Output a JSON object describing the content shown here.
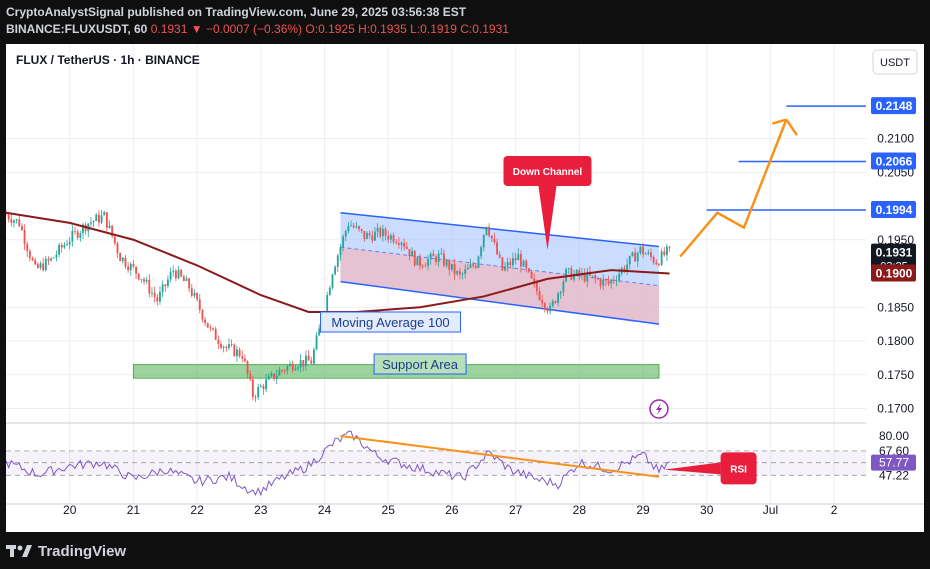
{
  "header": {
    "line1": "CryptoAnalystSignal published on TradingView.com, June 29, 2025 03:56:38 EST",
    "line2_symbol": "BINANCE:FLUXUSDT, 60",
    "line2_price": "0.1931",
    "line2_change": "−0.0007 (−0.36%)",
    "line2_o": "O:0.1925",
    "line2_h": "H:0.1935",
    "line2_l": "L:0.1919",
    "line2_c": "C:0.1931"
  },
  "legend": {
    "title": "FLUX / TetherUS · 1h · BINANCE"
  },
  "currency_button": "USDT",
  "footer": {
    "brand": "TradingView"
  },
  "colors": {
    "up": "#26a69a",
    "down": "#ef5350",
    "ma": "#8b1a1a",
    "channel": "#2962ff",
    "target": "#2962ff",
    "arrow": "#f7931a",
    "support": "#4caf50",
    "rsi": "#7e57c2",
    "rsi_trend": "#f7931a",
    "callout": "#e91e3d"
  },
  "chart_data": {
    "type": "candlestick",
    "timeframe": "1h",
    "y_axis": {
      "range": [
        0.168,
        0.224
      ],
      "ticks": [
        "0.2100",
        "0.2050",
        "0.1950",
        "0.1850",
        "0.1800",
        "0.1750",
        "0.1700"
      ]
    },
    "x_axis": {
      "range": [
        "2025-06-19 00:00",
        "2025-07-02 12:00"
      ],
      "ticks": [
        {
          "t": "2025-06-20",
          "label": "20"
        },
        {
          "t": "2025-06-21",
          "label": "21"
        },
        {
          "t": "2025-06-22",
          "label": "22"
        },
        {
          "t": "2025-06-23",
          "label": "23"
        },
        {
          "t": "2025-06-24",
          "label": "24"
        },
        {
          "t": "2025-06-25",
          "label": "25"
        },
        {
          "t": "2025-06-26",
          "label": "26"
        },
        {
          "t": "2025-06-27",
          "label": "27"
        },
        {
          "t": "2025-06-28",
          "label": "28"
        },
        {
          "t": "2025-06-29",
          "label": "29"
        },
        {
          "t": "2025-06-30",
          "label": "30"
        },
        {
          "t": "2025-07-01",
          "label": "Jul"
        },
        {
          "t": "2025-07-02",
          "label": "2"
        }
      ]
    },
    "price_path": [
      [
        "2025-06-19 00:00",
        0.199
      ],
      [
        "2025-06-19 06:00",
        0.1975
      ],
      [
        "2025-06-19 12:00",
        0.1905
      ],
      [
        "2025-06-19 18:00",
        0.192
      ],
      [
        "2025-06-20 00:00",
        0.1948
      ],
      [
        "2025-06-20 08:00",
        0.1975
      ],
      [
        "2025-06-20 14:00",
        0.1985
      ],
      [
        "2025-06-20 20:00",
        0.1925
      ],
      [
        "2025-06-21 04:00",
        0.1895
      ],
      [
        "2025-06-21 10:00",
        0.186
      ],
      [
        "2025-06-21 16:00",
        0.1905
      ],
      [
        "2025-06-21 22:00",
        0.188
      ],
      [
        "2025-06-22 06:00",
        0.1815
      ],
      [
        "2025-06-22 12:00",
        0.179
      ],
      [
        "2025-06-22 18:00",
        0.178
      ],
      [
        "2025-06-22 22:00",
        0.172
      ],
      [
        "2025-06-23 02:00",
        0.1735
      ],
      [
        "2025-06-23 08:00",
        0.1755
      ],
      [
        "2025-06-23 14:00",
        0.1768
      ],
      [
        "2025-06-23 20:00",
        0.177
      ],
      [
        "2025-06-24 00:00",
        0.183
      ],
      [
        "2025-06-24 04:00",
        0.1905
      ],
      [
        "2025-06-24 10:00",
        0.1975
      ],
      [
        "2025-06-24 16:00",
        0.1955
      ],
      [
        "2025-06-24 22:00",
        0.196
      ],
      [
        "2025-06-25 06:00",
        0.195
      ],
      [
        "2025-06-25 12:00",
        0.1915
      ],
      [
        "2025-06-25 20:00",
        0.1925
      ],
      [
        "2025-06-26 04:00",
        0.1895
      ],
      [
        "2025-06-26 10:00",
        0.1915
      ],
      [
        "2025-06-26 14:00",
        0.1975
      ],
      [
        "2025-06-26 20:00",
        0.1905
      ],
      [
        "2025-06-27 02:00",
        0.1925
      ],
      [
        "2025-06-27 08:00",
        0.188
      ],
      [
        "2025-06-27 14:00",
        0.1845
      ],
      [
        "2025-06-27 20:00",
        0.19
      ],
      [
        "2025-06-28 04:00",
        0.1895
      ],
      [
        "2025-06-28 12:00",
        0.1885
      ],
      [
        "2025-06-28 18:00",
        0.191
      ],
      [
        "2025-06-29 00:00",
        0.1935
      ],
      [
        "2025-06-29 06:00",
        0.1918
      ],
      [
        "2025-06-29 10:00",
        0.1931
      ]
    ],
    "moving_average": {
      "name": "Moving Average 100",
      "values": [
        [
          "2025-06-19 00:00",
          0.199
        ],
        [
          "2025-06-20 00:00",
          0.1975
        ],
        [
          "2025-06-21 00:00",
          0.195
        ],
        [
          "2025-06-22 00:00",
          0.1912
        ],
        [
          "2025-06-23 00:00",
          0.1868
        ],
        [
          "2025-06-23 18:00",
          0.1843
        ],
        [
          "2025-06-24 12:00",
          0.1843
        ],
        [
          "2025-06-25 12:00",
          0.185
        ],
        [
          "2025-06-26 12:00",
          0.1866
        ],
        [
          "2025-06-27 12:00",
          0.1892
        ],
        [
          "2025-06-28 12:00",
          0.1905
        ],
        [
          "2025-06-29 10:00",
          0.19
        ]
      ]
    },
    "down_channel": {
      "label": "Down Channel",
      "upper": [
        [
          "2025-06-24 06:00",
          0.199
        ],
        [
          "2025-06-29 06:00",
          0.194
        ]
      ],
      "lower": [
        [
          "2025-06-24 06:00",
          0.1888
        ],
        [
          "2025-06-29 06:00",
          0.1825
        ]
      ],
      "mid": [
        [
          "2025-06-24 06:00",
          0.1939
        ],
        [
          "2025-06-29 06:00",
          0.1882
        ]
      ]
    },
    "support_area": {
      "label": "Support Area",
      "from": "2025-06-21 00:00",
      "to": "2025-06-29 06:00",
      "top": 0.1765,
      "bottom": 0.1745
    },
    "target_levels": [
      {
        "price": "0.2148",
        "from": "2025-07-01 06:00"
      },
      {
        "price": "0.2066",
        "from": "2025-06-30 12:00"
      },
      {
        "price": "0.1994",
        "from": "2025-06-30 00:00"
      }
    ],
    "projection": [
      [
        "2025-06-29 14:00",
        0.1925
      ],
      [
        "2025-06-30 04:00",
        0.199
      ],
      [
        "2025-06-30 14:00",
        0.1968
      ],
      [
        "2025-07-01 06:00",
        0.2128
      ]
    ],
    "projection_tail": [
      [
        "2025-07-01 06:00",
        0.2128
      ],
      [
        "2025-07-01 10:00",
        0.2105
      ]
    ],
    "price_labels": [
      {
        "price": "0.2148",
        "style": "target"
      },
      {
        "price": "0.2066",
        "style": "target"
      },
      {
        "price": "0.1994",
        "style": "target"
      },
      {
        "price": "0.1931",
        "style": "current",
        "sub": "03:25"
      },
      {
        "price": "0.1900",
        "style": "ma"
      }
    ],
    "rsi": {
      "label": "RSI",
      "range": [
        30,
        85
      ],
      "levels": [
        "80.00",
        "67.60",
        "57.77",
        "47.22"
      ],
      "current": "57.77",
      "path": [
        [
          "2025-06-19 00:00",
          58
        ],
        [
          "2025-06-19 12:00",
          48
        ],
        [
          "2025-06-20 00:00",
          55
        ],
        [
          "2025-06-20 12:00",
          58
        ],
        [
          "2025-06-21 00:00",
          44
        ],
        [
          "2025-06-21 12:00",
          52
        ],
        [
          "2025-06-22 00:00",
          42
        ],
        [
          "2025-06-22 12:00",
          46
        ],
        [
          "2025-06-22 22:00",
          32
        ],
        [
          "2025-06-23 08:00",
          45
        ],
        [
          "2025-06-23 18:00",
          55
        ],
        [
          "2025-06-24 04:00",
          75
        ],
        [
          "2025-06-24 10:00",
          82
        ],
        [
          "2025-06-24 20:00",
          63
        ],
        [
          "2025-06-25 08:00",
          55
        ],
        [
          "2025-06-25 18:00",
          50
        ],
        [
          "2025-06-26 04:00",
          45
        ],
        [
          "2025-06-26 14:00",
          66
        ],
        [
          "2025-06-26 22:00",
          52
        ],
        [
          "2025-06-27 08:00",
          44
        ],
        [
          "2025-06-27 16:00",
          40
        ],
        [
          "2025-06-28 00:00",
          58
        ],
        [
          "2025-06-28 12:00",
          52
        ],
        [
          "2025-06-29 00:00",
          64
        ],
        [
          "2025-06-29 06:00",
          50
        ],
        [
          "2025-06-29 10:00",
          58
        ]
      ],
      "trendline": [
        [
          "2025-06-24 06:00",
          80
        ],
        [
          "2025-06-29 06:00",
          46
        ]
      ],
      "band": [
        47.22,
        67.6
      ]
    },
    "annotations": [
      "Down Channel",
      "Moving Average 100",
      "Support Area",
      "RSI"
    ]
  }
}
